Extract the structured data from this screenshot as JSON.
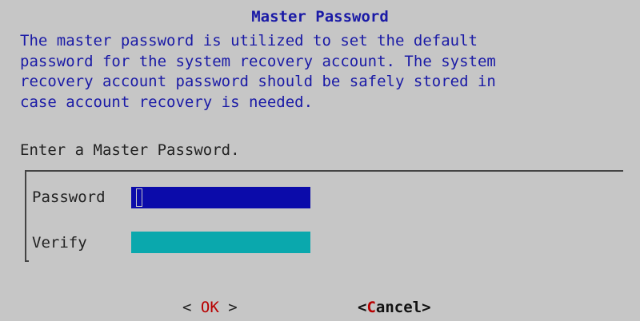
{
  "dialog": {
    "title": "Master Password",
    "description": "The master password is utilized to set the default\npassword for the system recovery account.  The system\nrecovery account password should be safely stored in\ncase account recovery is needed.",
    "prompt": "Enter a Master Password."
  },
  "form": {
    "password": {
      "label": "Password",
      "value": ""
    },
    "verify": {
      "label": "Verify",
      "value": ""
    }
  },
  "buttons": {
    "ok": {
      "left": "< ",
      "hotkey": "O",
      "rest": "K",
      "right": " >"
    },
    "cancel": {
      "left": "<",
      "hotkey": "C",
      "rest": "ancel",
      "right": ">"
    }
  },
  "colors": {
    "background": "#c6c6c6",
    "title_text": "#1a1aa6",
    "active_field": "#0b0baa",
    "inactive_field": "#0aa8ad",
    "hotkey": "#b80000"
  }
}
